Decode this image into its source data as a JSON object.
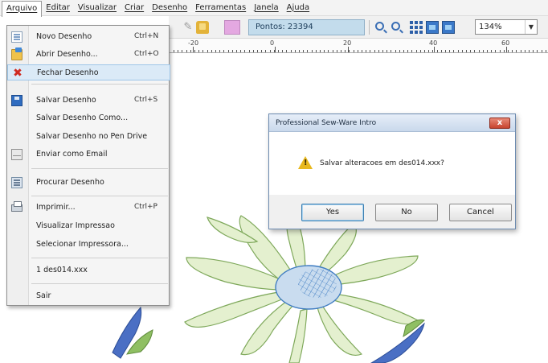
{
  "menubar": {
    "items": [
      {
        "label": "Arquivo",
        "active": true
      },
      {
        "label": "Editar"
      },
      {
        "label": "Visualizar"
      },
      {
        "label": "Criar"
      },
      {
        "label": "Desenho"
      },
      {
        "label": "Ferramentas"
      },
      {
        "label": "Janela"
      },
      {
        "label": "Ajuda"
      }
    ]
  },
  "toolbar": {
    "points_label": "Pontos: 23394",
    "zoom_value": "134%",
    "swatch_color": "#e4a8e1"
  },
  "ruler": {
    "labels": [
      "-20",
      "0",
      "20",
      "40",
      "60"
    ]
  },
  "file_menu": {
    "items": [
      {
        "label": "Novo Desenho",
        "shortcut": "Ctrl+N",
        "icon": "new-document-icon"
      },
      {
        "label": "Abrir Desenho...",
        "shortcut": "Ctrl+O",
        "icon": "open-folder-icon"
      },
      {
        "label": "Fechar Desenho",
        "shortcut": "",
        "icon": "close-x-icon",
        "highlighted": true
      },
      {
        "label": "Salvar Desenho",
        "shortcut": "Ctrl+S",
        "icon": "save-disk-icon"
      },
      {
        "label": "Salvar Desenho Como...",
        "shortcut": "",
        "icon": ""
      },
      {
        "label": "Salvar Desenho no Pen Drive",
        "shortcut": "",
        "icon": ""
      },
      {
        "label": "Enviar como Email",
        "shortcut": "",
        "icon": "email-icon"
      },
      {
        "label": "Procurar Desenho",
        "shortcut": "",
        "icon": "browse-icon"
      },
      {
        "label": "Imprimir...",
        "shortcut": "Ctrl+P",
        "icon": "printer-icon"
      },
      {
        "label": "Visualizar Impressao",
        "shortcut": "",
        "icon": ""
      },
      {
        "label": "Selecionar Impressora...",
        "shortcut": "",
        "icon": ""
      },
      {
        "label": "1 des014.xxx",
        "shortcut": "",
        "icon": ""
      },
      {
        "label": "Sair",
        "shortcut": "",
        "icon": ""
      }
    ]
  },
  "dialog": {
    "title": "Professional Sew-Ware Intro",
    "message": "Salvar alteracoes em des014.xxx?",
    "buttons": {
      "yes": "Yes",
      "no": "No",
      "cancel": "Cancel"
    },
    "close_glyph": "x"
  },
  "colors": {
    "petal_fill": "#e4f0cf",
    "petal_stroke": "#7ea85a",
    "center_fill": "#c9dcef",
    "center_hatch": "#3f7cc2",
    "leaf_blue": "#4a6fc4",
    "leaf_green": "#6fa04a"
  }
}
